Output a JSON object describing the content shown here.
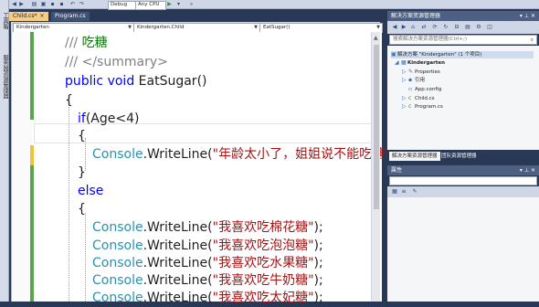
{
  "left_strip": {
    "items": [
      "工具箱",
      "服务器资源管理器"
    ]
  },
  "toolbar": {
    "config": "Debug",
    "platform": "Any CPU",
    "icons": [
      "back-icon",
      "forward-icon",
      "new-icon",
      "open-icon",
      "save-icon",
      "save-all-icon",
      "undo-icon",
      "redo-icon",
      "start-icon",
      "attach-icon",
      "find-icon"
    ]
  },
  "tabs": [
    {
      "label": "Child.cs*",
      "close": "×",
      "active": true
    },
    {
      "label": "Program.cs",
      "active": false
    }
  ],
  "navbar": {
    "project": "Kindergarten",
    "type": "Kindergarten.Child",
    "member": "EatSugar()"
  },
  "code": {
    "line1_prefix": "/// ",
    "line1_text": "吃糖",
    "line2": "/// </summary>",
    "line3_kw1": "public",
    "line3_kw2": "void",
    "line3_name": "EatSugar()",
    "brace_open": "{",
    "brace_close": "}",
    "if_kw": "if",
    "if_cond": "(Age<4)",
    "console": "Console",
    "writeline": ".WriteLine(",
    "close_call": ");",
    "str1": "\"年龄太小了，姐姐说不能吃糖\"",
    "else_kw": "else",
    "else_lines": [
      "\"我喜欢吃棉花糖\"",
      "\"我喜欢吃泡泡糖\"",
      "\"我喜欢吃水果糖\"",
      "\"我喜欢吃牛奶糖\"",
      "\"我喜欢吃太妃糖\""
    ]
  },
  "solution_explorer": {
    "title": "解决方案资源管理器",
    "search_placeholder": "搜索解决方案资源管理器(Ctrl+;)",
    "tree": {
      "solution": "解决方案 \"Kindergarten\" (1 个项目)",
      "project": "Kindergarten",
      "properties": "Properties",
      "references": "引用",
      "app_config": "App.config",
      "child_cs": "Child.cs",
      "program_cs": "Program.cs"
    },
    "tabs": [
      "解决方案资源管理器",
      "团队资源管理器"
    ]
  },
  "properties": {
    "title": "属性"
  },
  "colors": {
    "keyword": "#0000ff",
    "comment": "#008000",
    "type": "#2b91af",
    "string": "#a31515",
    "change_saved": "#57a64a",
    "change_unsaved": "#f0c23b",
    "chrome": "#293955"
  }
}
